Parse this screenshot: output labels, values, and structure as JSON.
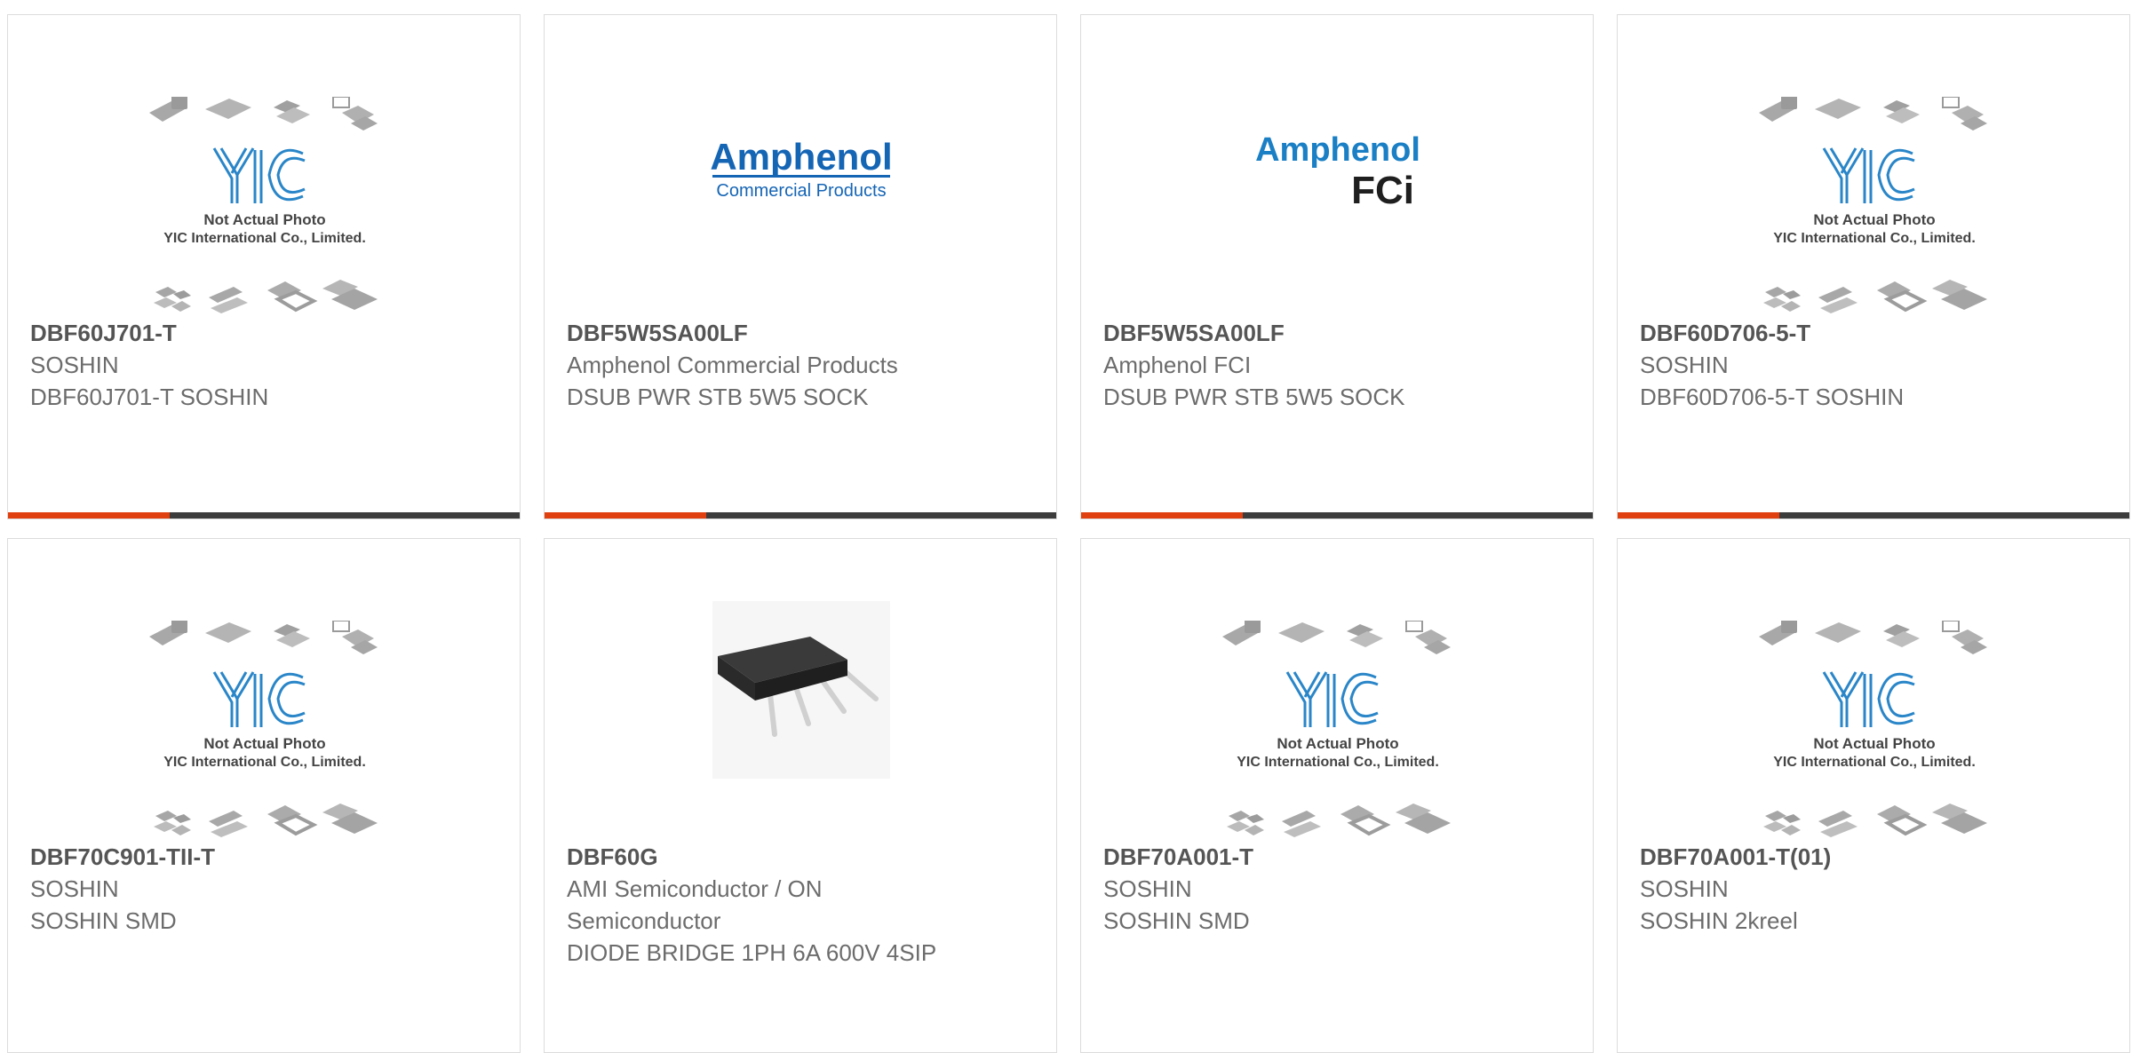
{
  "colors": {
    "accent": "#e0400f",
    "bar": "#3c3c3c",
    "yic_blue": "#2a86c8",
    "amphenol_blue": "#1565b5"
  },
  "placeholder": {
    "line1": "Not Actual Photo",
    "line2": "YIC International Co., Limited.",
    "logo_text": "YIC"
  },
  "amphenol_commercial": {
    "brand": "Amphenol",
    "sub": "Commercial Products"
  },
  "amphenol_fci": {
    "brand": "Amphenol",
    "sub": "FCi"
  },
  "products": [
    {
      "part": "DBF60J701-T",
      "manufacturer": "SOSHIN",
      "description": "DBF60J701-T SOSHIN",
      "image": "yic-placeholder"
    },
    {
      "part": "DBF5W5SA00LF",
      "manufacturer": "Amphenol Commercial Products",
      "description": "DSUB PWR STB 5W5 SOCK",
      "image": "amphenol-commercial-logo"
    },
    {
      "part": "DBF5W5SA00LF",
      "manufacturer": "Amphenol FCI",
      "description": "DSUB PWR STB 5W5 SOCK",
      "image": "amphenol-fci-logo"
    },
    {
      "part": "DBF60D706-5-T",
      "manufacturer": "SOSHIN",
      "description": "DBF60D706-5-T SOSHIN",
      "image": "yic-placeholder"
    },
    {
      "part": "DBF70C901-TII-T",
      "manufacturer": "SOSHIN",
      "description": "SOSHIN SMD",
      "image": "yic-placeholder"
    },
    {
      "part": "DBF60G",
      "manufacturer": "AMI Semiconductor / ON Semiconductor",
      "description": "DIODE BRIDGE 1PH 6A 600V 4SIP",
      "image": "sip4-bridge-photo"
    },
    {
      "part": "DBF70A001-T",
      "manufacturer": "SOSHIN",
      "description": "SOSHIN SMD",
      "image": "yic-placeholder"
    },
    {
      "part": "DBF70A001-T(01)",
      "manufacturer": "SOSHIN",
      "description": "SOSHIN 2kreel",
      "image": "yic-placeholder"
    }
  ]
}
